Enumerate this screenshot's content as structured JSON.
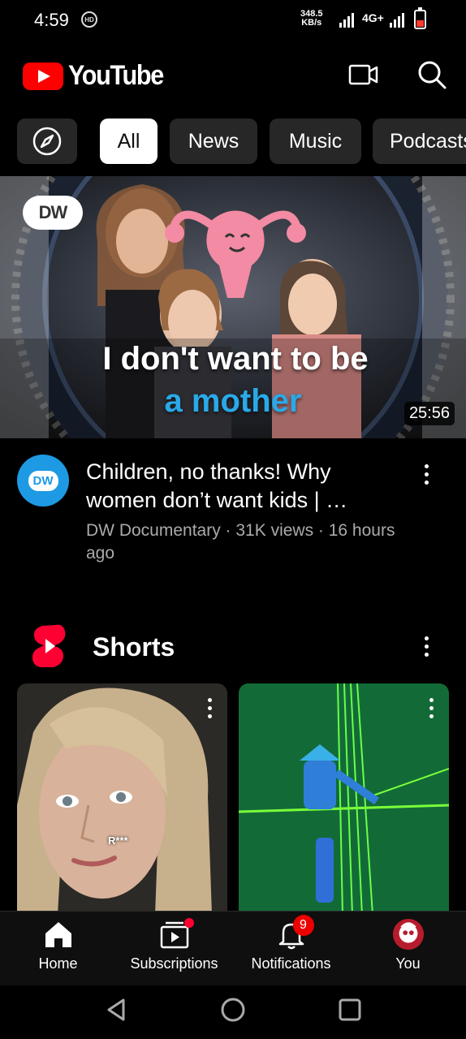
{
  "status": {
    "time": "4:59",
    "hd_icon": "HD",
    "speed_value": "348.5",
    "speed_unit": "KB/s",
    "network": "4G+"
  },
  "header": {
    "brand": "YouTube",
    "cast_icon": "camera-icon",
    "search_icon": "search-icon"
  },
  "chips": [
    "All",
    "News",
    "Music",
    "Podcasts"
  ],
  "video": {
    "thumbnail_line1": "I don't want to be",
    "thumbnail_line2": "a mother",
    "thumbnail_badge": "DW",
    "duration": "25:56",
    "title": "Children, no thanks! Why women don’t want kids | …",
    "channel": "DW Documentary",
    "views": "31K views",
    "age": "16 hours ago",
    "subtitle": "DW Documentary · 31K views · 16 hours ago",
    "avatar_text": "DW"
  },
  "shorts": {
    "title": "Shorts",
    "items": [
      {
        "overlay": "R***"
      },
      {
        "overlay": ""
      }
    ]
  },
  "nav": {
    "home": "Home",
    "subscriptions": "Subscriptions",
    "notifications": "Notifications",
    "notifications_badge": "9",
    "you": "You"
  },
  "colors": {
    "brand_red": "#ff0000",
    "background": "#000000",
    "chip_bg": "#272727",
    "accent_blue": "#2aa9e8"
  }
}
